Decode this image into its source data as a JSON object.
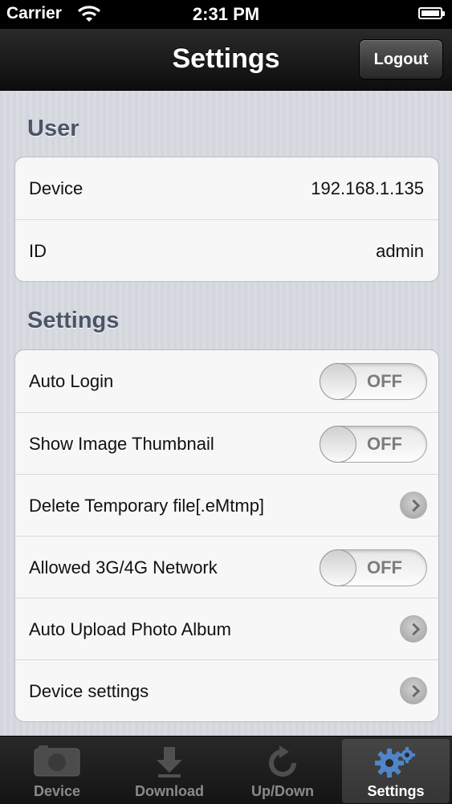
{
  "status_bar": {
    "carrier": "Carrier",
    "time": "2:31 PM"
  },
  "nav": {
    "title": "Settings",
    "logout_label": "Logout"
  },
  "user_section": {
    "title": "User",
    "rows": [
      {
        "label": "Device",
        "value": "192.168.1.135"
      },
      {
        "label": "ID",
        "value": "admin"
      }
    ]
  },
  "settings_section": {
    "title": "Settings",
    "rows": [
      {
        "label": "Auto Login",
        "control": "toggle",
        "state": "OFF"
      },
      {
        "label": "Show Image Thumbnail",
        "control": "toggle",
        "state": "OFF"
      },
      {
        "label": "Delete Temporary file[.eMtmp]",
        "control": "disclosure"
      },
      {
        "label": "Allowed 3G/4G Network",
        "control": "toggle",
        "state": "OFF"
      },
      {
        "label": "Auto Upload Photo Album",
        "control": "disclosure"
      },
      {
        "label": "Device settings",
        "control": "disclosure"
      }
    ]
  },
  "tab_bar": {
    "tabs": [
      {
        "label": "Device",
        "icon": "camera-icon"
      },
      {
        "label": "Download",
        "icon": "download-arrow-icon"
      },
      {
        "label": "Up/Down",
        "icon": "refresh-icon"
      },
      {
        "label": "Settings",
        "icon": "gears-icon",
        "selected": true
      }
    ]
  }
}
